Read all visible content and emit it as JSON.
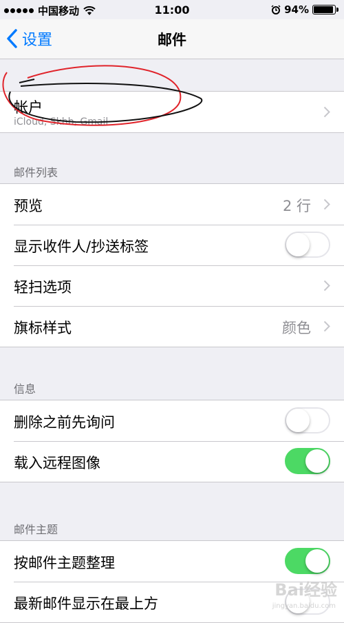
{
  "status_bar": {
    "carrier": "中国移动",
    "time": "11:00",
    "battery_percent": "94%",
    "battery_level": 0.94,
    "icons": [
      "signal-dots-icon",
      "wifi-icon",
      "alarm-icon",
      "battery-icon"
    ]
  },
  "nav": {
    "back_label": "设置",
    "title": "邮件"
  },
  "accounts": {
    "label": "帐户",
    "sublabel": "iCloud, Skhb, Gmail"
  },
  "sections": {
    "mail_list": "邮件列表",
    "messages": "信息",
    "threading": "邮件主题"
  },
  "mail_list_rows": {
    "preview": {
      "label": "预览",
      "value": "2 行"
    },
    "show_to_cc": {
      "label": "显示收件人/抄送标签",
      "on": false
    },
    "swipe_options": {
      "label": "轻扫选项"
    },
    "flag_style": {
      "label": "旗标样式",
      "value": "颜色"
    }
  },
  "message_rows": {
    "ask_before_delete": {
      "label": "删除之前先询问",
      "on": false
    },
    "load_remote_images": {
      "label": "载入远程图像",
      "on": true
    }
  },
  "thread_rows": {
    "organize_by_thread": {
      "label": "按邮件主题整理",
      "on": true
    },
    "most_recent_on_top": {
      "label": "最新邮件显示在最上方",
      "on": false
    }
  },
  "colors": {
    "ios_blue": "#007aff",
    "toggle_green": "#4cd964",
    "background": "#efeff4"
  },
  "watermark": {
    "text": "Bai经验",
    "sub": "jingyan.baidu.com"
  }
}
